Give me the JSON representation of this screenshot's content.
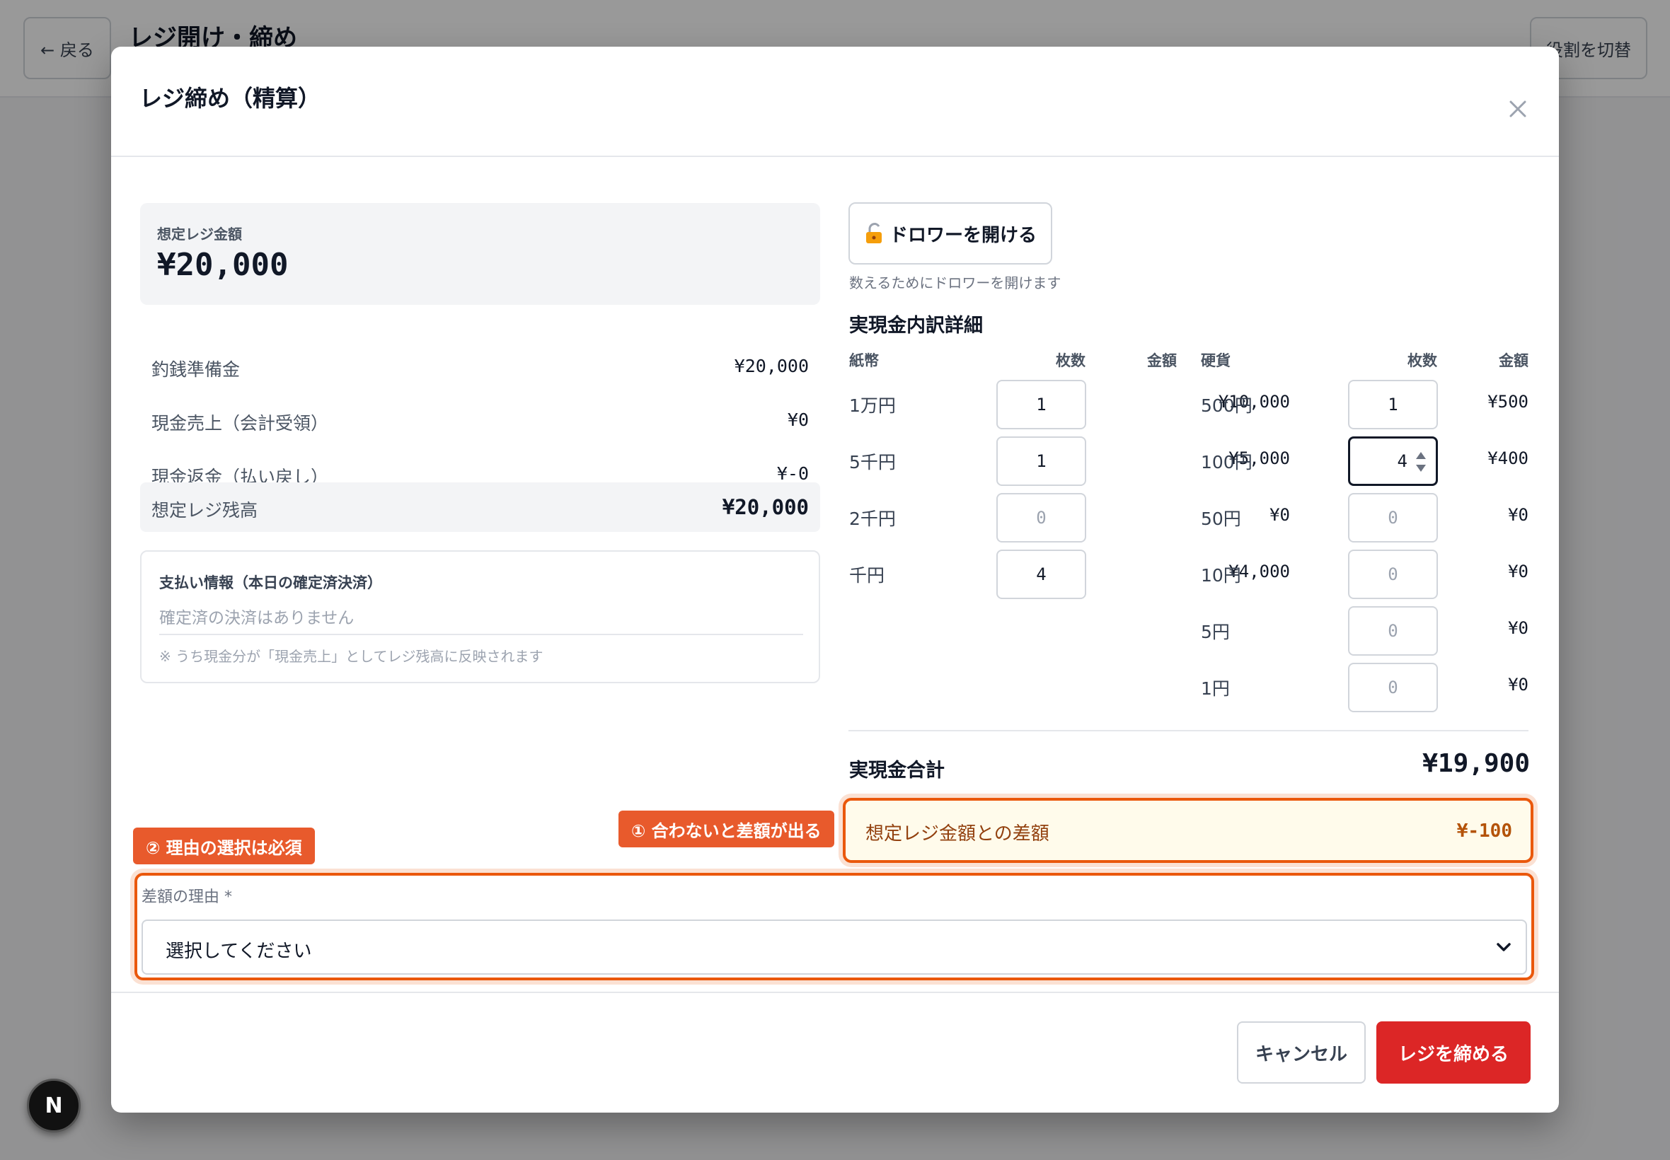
{
  "background": {
    "back_label": "← 戻る",
    "page_title": "レジ開け・締め",
    "role_switch_label": "役割を切替",
    "next_badge": "N"
  },
  "modal": {
    "title": "レジ締め（精算）",
    "close_icon": "close-icon",
    "expected": {
      "label": "想定レジ金額",
      "value": "¥20,000"
    },
    "summary": [
      {
        "label": "釣銭準備金",
        "value": "¥20,000"
      },
      {
        "label": "現金売上（会計受領）",
        "value": "¥0"
      },
      {
        "label": "現金返金（払い戻し）",
        "value": "¥-0"
      }
    ],
    "balance": {
      "label": "想定レジ残高",
      "value": "¥20,000"
    },
    "payments": {
      "title": "支払い情報（本日の確定済決済）",
      "empty": "確定済の決済はありません",
      "note": "※ うち現金分が「現金売上」としてレジ残高に反映されます"
    },
    "drawer": {
      "button_label": "ドロワーを開ける",
      "icon": "unlock-icon",
      "hint": "数えるためにドロワーを開けます"
    },
    "breakdown": {
      "title": "実現金内訳詳細",
      "bills": {
        "header": "紙幣",
        "qty_header": "枚数",
        "amount_header": "金額",
        "rows": [
          {
            "label": "1万円",
            "qty": "1",
            "amount": "¥10,000"
          },
          {
            "label": "5千円",
            "qty": "1",
            "amount": "¥5,000"
          },
          {
            "label": "2千円",
            "qty": "0",
            "amount": "¥0"
          },
          {
            "label": "千円",
            "qty": "4",
            "amount": "¥4,000"
          }
        ]
      },
      "coins": {
        "header": "硬貨",
        "qty_header": "枚数",
        "amount_header": "金額",
        "rows": [
          {
            "label": "500円",
            "qty": "1",
            "amount": "¥500"
          },
          {
            "label": "100円",
            "qty": "4",
            "amount": "¥400"
          },
          {
            "label": "50円",
            "qty": "0",
            "amount": "¥0"
          },
          {
            "label": "10円",
            "qty": "0",
            "amount": "¥0"
          },
          {
            "label": "5円",
            "qty": "0",
            "amount": "¥0"
          },
          {
            "label": "1円",
            "qty": "0",
            "amount": "¥0"
          }
        ]
      }
    },
    "total": {
      "label": "実現金合計",
      "value": "¥19,900"
    },
    "difference": {
      "label": "想定レジ金額との差額",
      "value": "¥-100"
    },
    "callouts": {
      "difference": "① 合わないと差額が出る",
      "reason": "② 理由の選択は必須"
    },
    "reason": {
      "label": "差額の理由 *",
      "selected": "選択してください"
    },
    "footer": {
      "cancel_label": "キャンセル",
      "submit_label": "レジを締める"
    }
  },
  "colors": {
    "accent_red": "#dc2626",
    "highlight_orange": "#ea580c",
    "callout_orange": "#e85a2c",
    "difference_bg": "#fffbeb"
  }
}
